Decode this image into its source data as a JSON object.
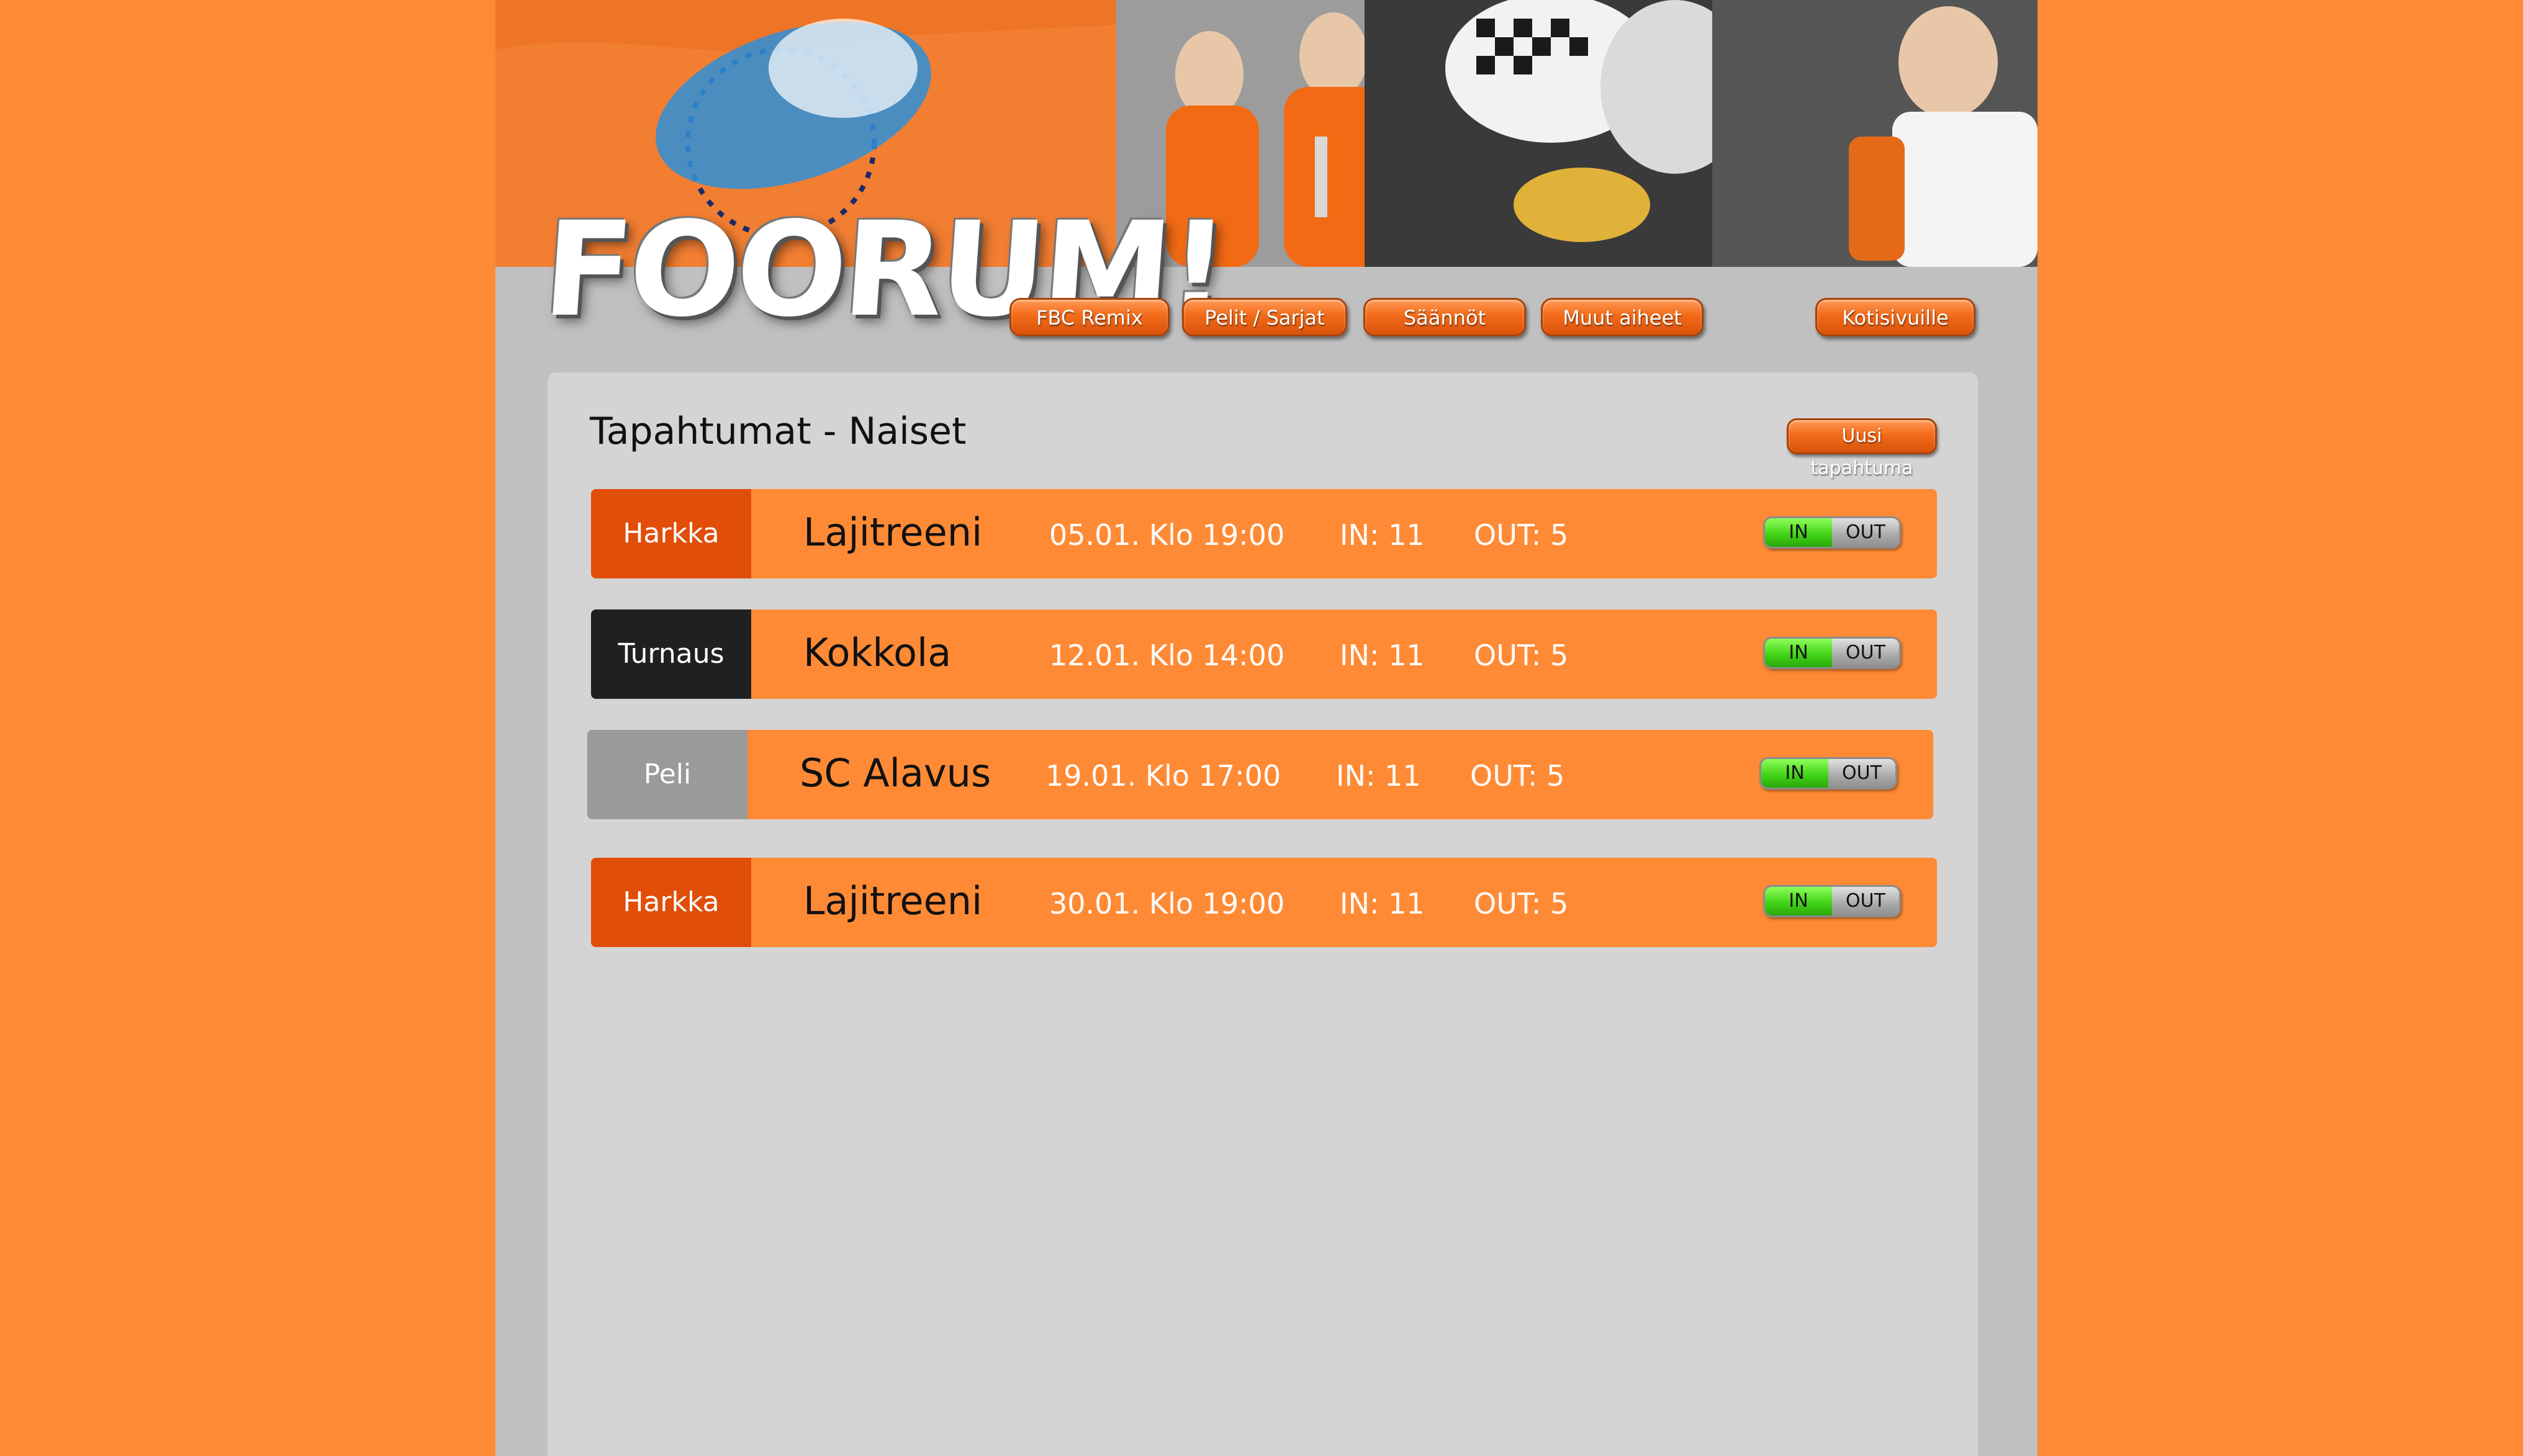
{
  "logo": {
    "text": "FOORUM!"
  },
  "nav": {
    "items": [
      {
        "label": "FBC Remix"
      },
      {
        "label": "Pelit / Sarjat"
      },
      {
        "label": "Säännöt"
      },
      {
        "label": "Muut aiheet"
      },
      {
        "label": "Kotisivuille"
      }
    ]
  },
  "panel": {
    "title": "Tapahtumat - Naiset",
    "new_event_label": "Uusi tapahtuma"
  },
  "toggle": {
    "in_label": "IN",
    "out_label": "OUT"
  },
  "events": [
    {
      "type": "Harkka",
      "type_color": "#e04e0a",
      "name": "Lajitreeni",
      "date": "05.01. Klo 19:00",
      "in": "IN: 11",
      "out": "OUT: 5"
    },
    {
      "type": "Turnaus",
      "type_color": "#202020",
      "name": "Kokkola",
      "date": "12.01. Klo 14:00",
      "in": "IN: 11",
      "out": "OUT: 5"
    },
    {
      "type": "Peli",
      "type_color": "#9a9a9a",
      "name": "SC Alavus",
      "date": "19.01. Klo 17:00",
      "in": "IN: 11",
      "out": "OUT: 5"
    },
    {
      "type": "Harkka",
      "type_color": "#e04e0a",
      "name": "Lajitreeni",
      "date": "30.01. Klo 19:00",
      "in": "IN: 11",
      "out": "OUT: 5"
    }
  ],
  "colors": {
    "page_bg": "#ff8a35",
    "column_bg": "#c0c0c0",
    "panel_bg": "#d4d4d4",
    "row_bg": "#ff8a35"
  }
}
